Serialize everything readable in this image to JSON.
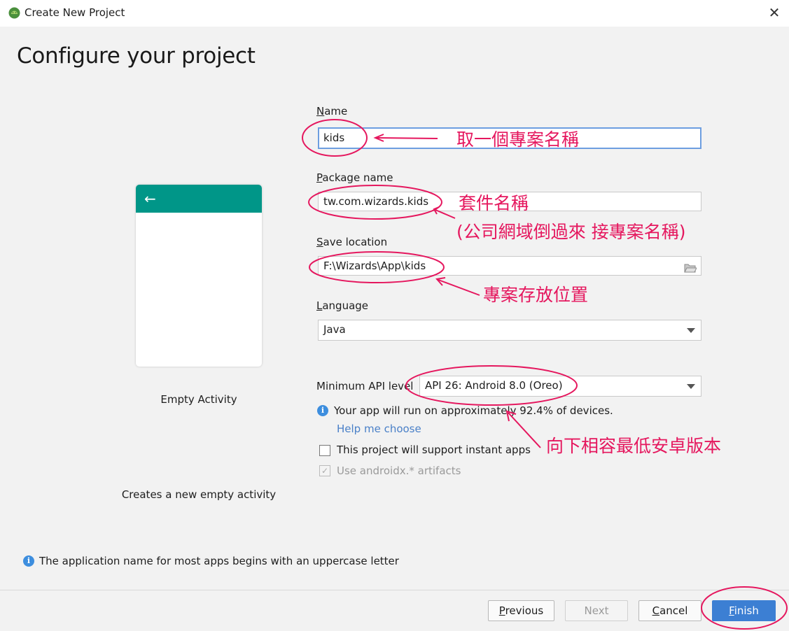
{
  "window": {
    "title": "Create New Project",
    "close_glyph": "✕"
  },
  "heading": "Configure your project",
  "preview": {
    "back_glyph": "←",
    "activity_name": "Empty Activity",
    "description": "Creates a new empty activity",
    "toolbar_color": "#009688"
  },
  "form": {
    "name": {
      "label_mnemonic": "N",
      "label_rest": "ame",
      "value": "kids"
    },
    "package": {
      "label_mnemonic": "P",
      "label_rest": "ackage name",
      "value": "tw.com.wizards.kids"
    },
    "location": {
      "label_mnemonic": "S",
      "label_rest": "ave location",
      "value": "F:\\Wizards\\App\\kids",
      "folder_icon": "folder-icon"
    },
    "language": {
      "label_mnemonic": "L",
      "label_rest": "anguage",
      "value": "Java"
    },
    "min_api": {
      "label": "Minimum API level",
      "value": "API 26: Android 8.0 (Oreo)"
    },
    "run_info": "Your app will run on approximately 92.4% of devices.",
    "help_link": "Help me choose",
    "instant_apps": {
      "label": "This project will support instant apps",
      "checked": false
    },
    "androidx": {
      "label": "Use androidx.* artifacts",
      "checked": true,
      "enabled": false
    }
  },
  "footer_info": "The application name for most apps begins with an uppercase letter",
  "buttons": {
    "previous": {
      "mnemonic": "P",
      "rest": "revious"
    },
    "next": "Next",
    "cancel": {
      "mnemonic": "C",
      "rest": "ancel"
    },
    "finish": {
      "mnemonic": "F",
      "rest": "inish"
    }
  },
  "annotations": {
    "name_note": "取一個專案名稱",
    "package_note": "套件名稱",
    "package_sub": "(公司網域倒過來 接專案名稱)",
    "location_note": "專案存放位置",
    "api_note": "向下相容最低安卓版本",
    "color": "#e5175e"
  },
  "colors": {
    "accent": "#3c7fd3",
    "link": "#4a80c8",
    "info": "#3d8ede"
  }
}
